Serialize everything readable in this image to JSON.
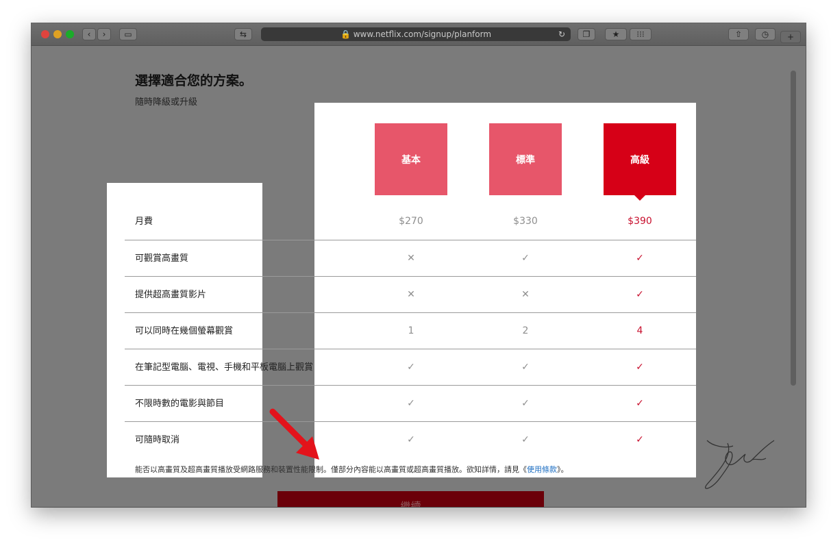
{
  "browser": {
    "url": "www.netflix.com/signup/planform",
    "lock_icon": "lock-icon",
    "colors": {
      "close": "#e0443e",
      "minimize": "#dea123",
      "zoom": "#1aab29"
    }
  },
  "page": {
    "title": "選擇適合您的方案。",
    "subtitle": "隨時降級或升級"
  },
  "plans": [
    {
      "name": "基本",
      "color": "#e7566a"
    },
    {
      "name": "標準",
      "color": "#e7566a"
    },
    {
      "name": "高級",
      "color": "#d60017"
    }
  ],
  "rows": [
    {
      "label": "月費",
      "values": [
        "$270",
        "$330",
        "$390"
      ]
    },
    {
      "label": "可觀賞高畫質",
      "values": [
        "✕",
        "✓",
        "✓"
      ]
    },
    {
      "label": "提供超高畫質影片",
      "values": [
        "✕",
        "✕",
        "✓"
      ]
    },
    {
      "label": "可以同時在幾個螢幕觀賞",
      "values": [
        "1",
        "2",
        "4"
      ]
    },
    {
      "label": "在筆記型電腦、電視、手機和平板電腦上觀賞",
      "values": [
        "✓",
        "✓",
        "✓"
      ]
    },
    {
      "label": "不限時數的電影與節目",
      "values": [
        "✓",
        "✓",
        "✓"
      ]
    },
    {
      "label": "可隨時取消",
      "values": [
        "✓",
        "✓",
        "✓"
      ]
    }
  ],
  "footnote": {
    "text": "能否以高畫質及超高畫質播放受網路服務和裝置性能限制。僅部分內容能以高畫質或超高畫質播放。欲知詳情，請見《",
    "link": "使用條款",
    "suffix": "》。"
  },
  "continue_button": {
    "label": "繼續"
  },
  "accent_color": "#d60017"
}
